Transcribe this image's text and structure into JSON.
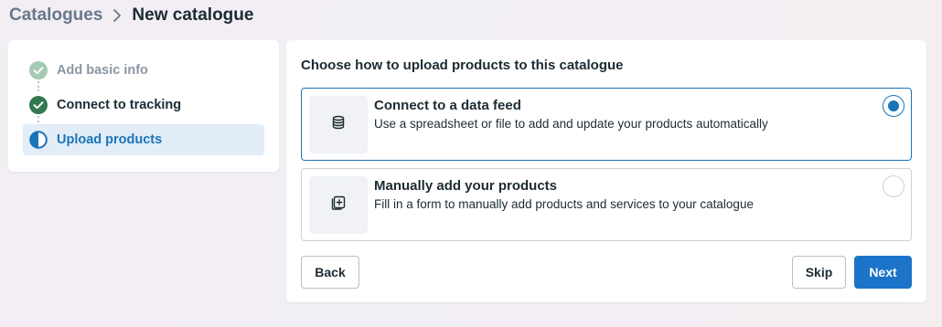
{
  "breadcrumb": {
    "parent": "Catalogues",
    "current": "New catalogue"
  },
  "steps": [
    {
      "label": "Add basic info",
      "state": "completed"
    },
    {
      "label": "Connect to tracking",
      "state": "completed"
    },
    {
      "label": "Upload products",
      "state": "in-progress"
    }
  ],
  "main": {
    "title": "Choose how to upload products to this catalogue",
    "options": [
      {
        "title": "Connect to a data feed",
        "description": "Use a spreadsheet or file to add and update your products automatically",
        "icon": "database-icon",
        "selected": true
      },
      {
        "title": "Manually add your products",
        "description": "Fill in a form to manually add products and services to your catalogue",
        "icon": "add-item-icon",
        "selected": false
      }
    ],
    "buttons": {
      "back": "Back",
      "skip": "Skip",
      "next": "Next"
    }
  },
  "colors": {
    "accent": "#1b74c8",
    "step_completed_dark": "#31794f",
    "step_completed_light": "#a5c9b2",
    "selected_step_bg": "#e2edf7"
  }
}
